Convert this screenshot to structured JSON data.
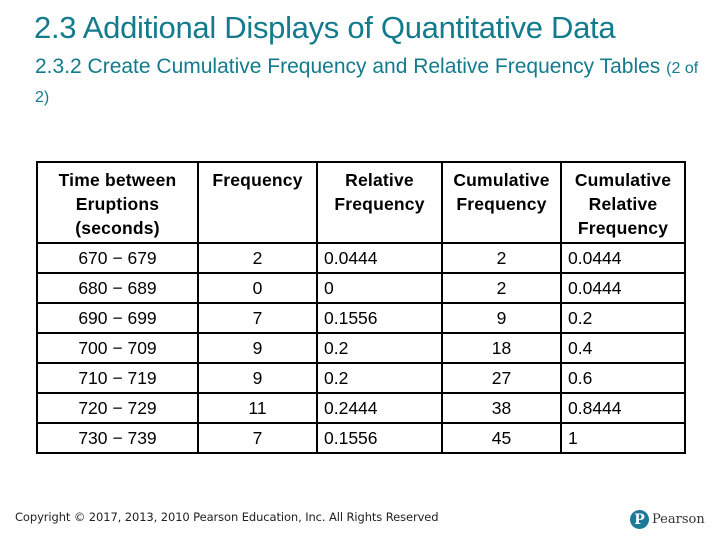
{
  "slide": {
    "title": "2.3 Additional Displays of Quantitative Data",
    "subtitle_main": "2.3.2 Create Cumulative Frequency and Relative Frequency Tables",
    "subtitle_part": "(2 of 2)"
  },
  "table": {
    "headers": [
      "Time between Eruptions (seconds)",
      "Frequency",
      "Relative Frequency",
      "Cumulative Frequency",
      "Cumulative Relative Frequency"
    ],
    "rows": [
      {
        "interval": "670 − 679",
        "frequency": "2",
        "relative_frequency": "0.0444",
        "cumulative_frequency": "2",
        "cumulative_relative_frequency": "0.0444"
      },
      {
        "interval": "680 − 689",
        "frequency": "0",
        "relative_frequency": "0",
        "cumulative_frequency": "2",
        "cumulative_relative_frequency": "0.0444"
      },
      {
        "interval": "690 − 699",
        "frequency": "7",
        "relative_frequency": "0.1556",
        "cumulative_frequency": "9",
        "cumulative_relative_frequency": "0.2"
      },
      {
        "interval": "700 − 709",
        "frequency": "9",
        "relative_frequency": "0.2",
        "cumulative_frequency": "18",
        "cumulative_relative_frequency": "0.4"
      },
      {
        "interval": "710 − 719",
        "frequency": "9",
        "relative_frequency": "0.2",
        "cumulative_frequency": "27",
        "cumulative_relative_frequency": "0.6"
      },
      {
        "interval": "720 − 729",
        "frequency": "11",
        "relative_frequency": "0.2444",
        "cumulative_frequency": "38",
        "cumulative_relative_frequency": "0.8444"
      },
      {
        "interval": "730 − 739",
        "frequency": "7",
        "relative_frequency": "0.1556",
        "cumulative_frequency": "45",
        "cumulative_relative_frequency": "1"
      }
    ]
  },
  "footer": {
    "copyright": "Copyright © 2017, 2013, 2010 Pearson Education, Inc. All Rights Reserved"
  },
  "logo": {
    "icon": "pearson-logo-icon",
    "glyph": "P",
    "text": "Pearson",
    "color": "#1b7a99"
  },
  "colors": {
    "title": "#137b8c",
    "table_border": "#000000"
  }
}
